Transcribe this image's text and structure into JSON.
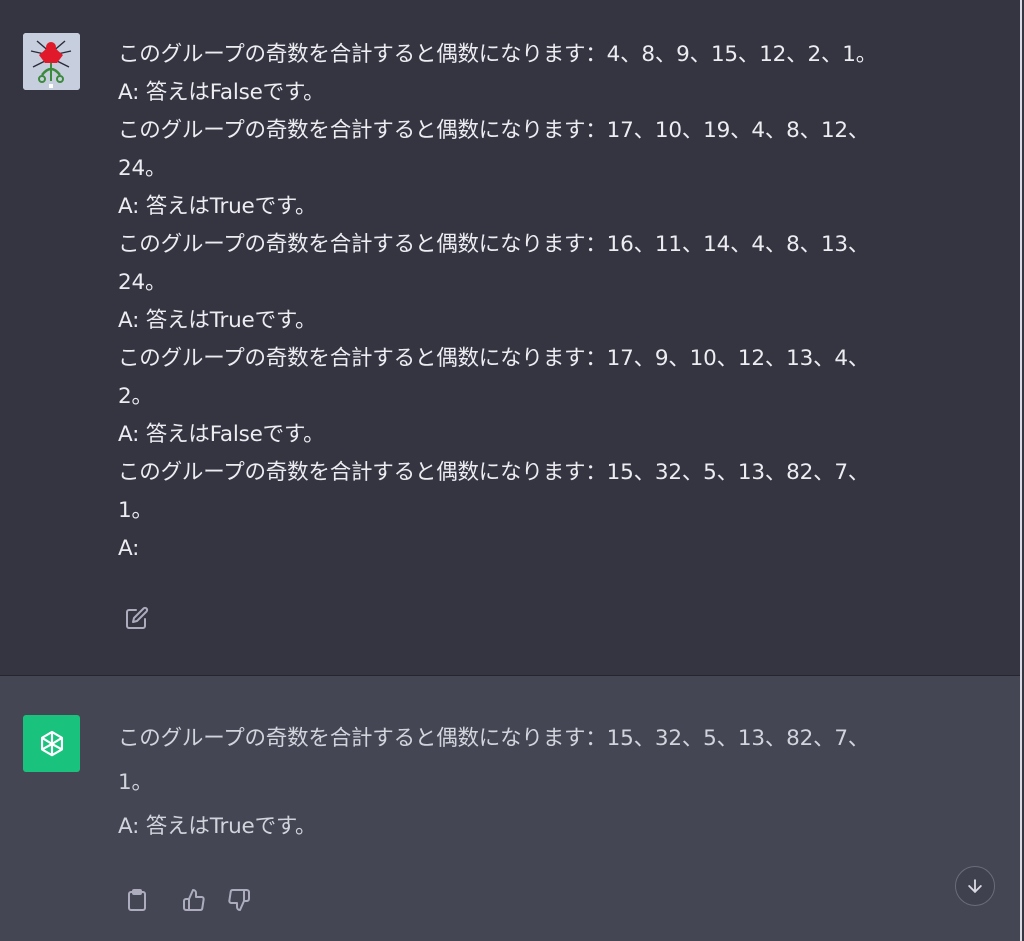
{
  "user_message": {
    "lines": [
      "このグループの奇数を合計すると偶数になります：4、8、9、15、12、2、1。",
      "A: 答えはFalseです。",
      "このグループの奇数を合計すると偶数になります：17、10、19、4、8、12、",
      "24。",
      "A: 答えはTrueです。",
      "このグループの奇数を合計すると偶数になります：16、11、14、4、8、13、",
      "24。",
      "A: 答えはTrueです。",
      "このグループの奇数を合計すると偶数になります：17、9、10、12、13、4、",
      "2。",
      "A: 答えはFalseです。",
      "このグループの奇数を合計すると偶数になります：15、32、5、13、82、7、",
      "1。",
      "A:"
    ]
  },
  "assistant_message": {
    "lines": [
      "このグループの奇数を合計すると偶数になります：15、32、5、13、82、7、",
      "1。",
      "A: 答えはTrueです。"
    ]
  },
  "icons": {
    "edit": "edit-icon",
    "copy": "clipboard-icon",
    "thumbs_up": "thumbs-up-icon",
    "thumbs_down": "thumbs-down-icon",
    "scroll_down": "arrow-down-icon",
    "assistant_logo": "openai-logo-icon",
    "user_avatar": "user-avatar-image"
  },
  "colors": {
    "user_bg": "#343541",
    "assistant_bg": "#444654",
    "assistant_avatar": "#19c37d",
    "text": "#ececf1"
  }
}
